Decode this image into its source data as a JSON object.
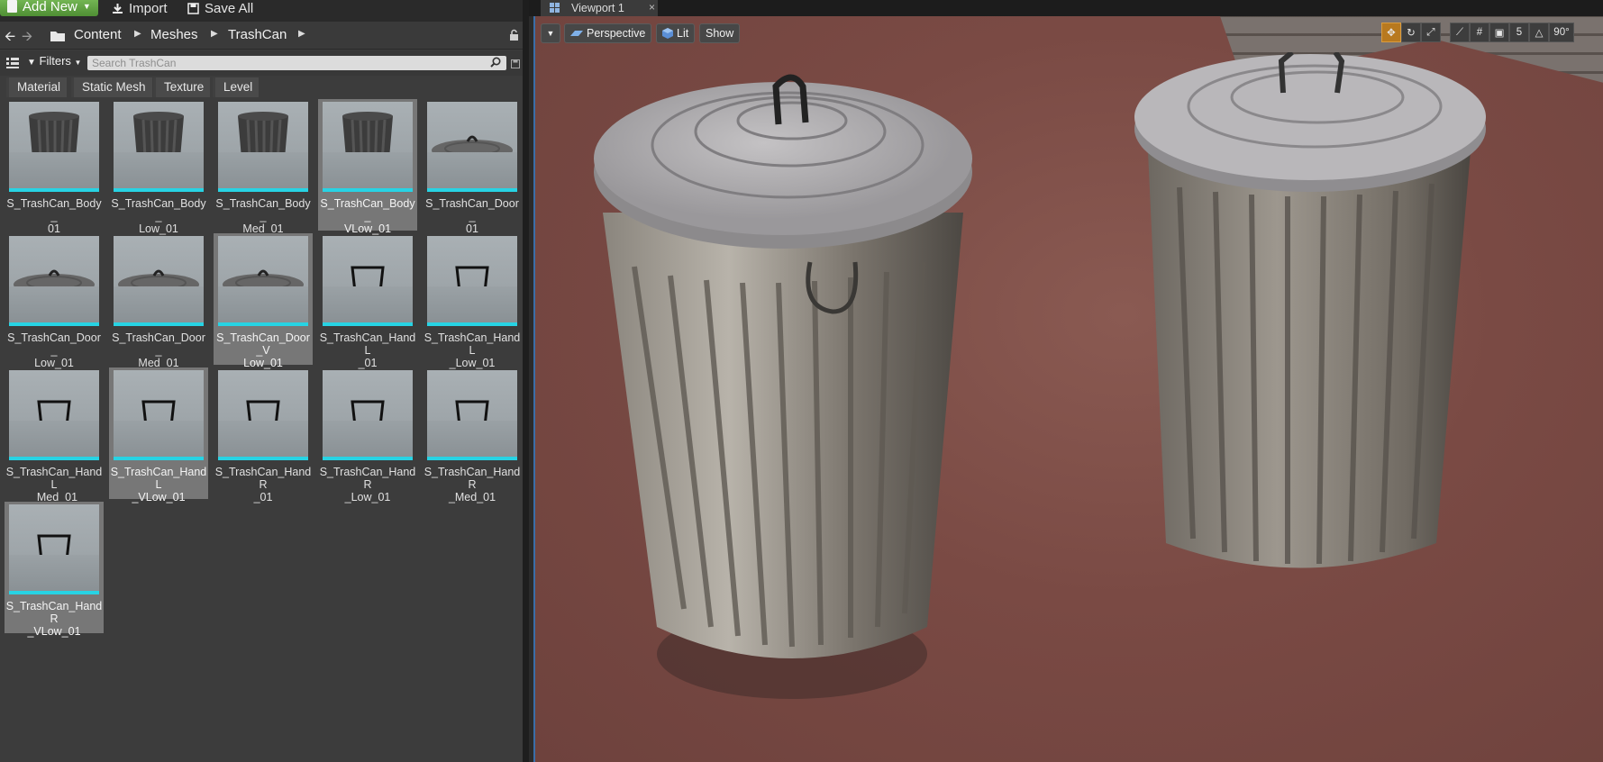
{
  "toolbar": {
    "add_new_label": "Add New",
    "import_label": "Import",
    "save_all_label": "Save All"
  },
  "breadcrumb": {
    "items": [
      "Content",
      "Meshes",
      "TrashCan"
    ]
  },
  "search": {
    "filters_label": "Filters",
    "placeholder": "Search TrashCan"
  },
  "filter_tags": [
    "Material",
    "Static Mesh",
    "Texture",
    "Level"
  ],
  "assets": [
    {
      "label": "S_TrashCan_Body_01",
      "kind": "body",
      "selected": false
    },
    {
      "label": "S_TrashCan_Body_Low_01",
      "kind": "body",
      "selected": false
    },
    {
      "label": "S_TrashCan_Body_Med_01",
      "kind": "body",
      "selected": false
    },
    {
      "label": "S_TrashCan_Body_VLow_01",
      "kind": "body",
      "selected": true
    },
    {
      "label": "S_TrashCan_Door_01",
      "kind": "lid",
      "selected": false
    },
    {
      "label": "S_TrashCan_Door_Low_01",
      "kind": "lid",
      "selected": false
    },
    {
      "label": "S_TrashCan_Door_Med_01",
      "kind": "lid",
      "selected": false
    },
    {
      "label": "S_TrashCan_Door_VLow_01",
      "kind": "lid",
      "selected": true
    },
    {
      "label": "S_TrashCan_HandL_01",
      "kind": "handle",
      "selected": false
    },
    {
      "label": "S_TrashCan_HandL_Low_01",
      "kind": "handle",
      "selected": false
    },
    {
      "label": "S_TrashCan_HandL_Med_01",
      "kind": "handle",
      "selected": false
    },
    {
      "label": "S_TrashCan_HandL_VLow_01",
      "kind": "handle",
      "selected": true
    },
    {
      "label": "S_TrashCan_HandR_01",
      "kind": "handle",
      "selected": false
    },
    {
      "label": "S_TrashCan_HandR_Low_01",
      "kind": "handle",
      "selected": false
    },
    {
      "label": "S_TrashCan_HandR_Med_01",
      "kind": "handle",
      "selected": false
    },
    {
      "label": "S_TrashCan_HandR_VLow_01",
      "kind": "handle",
      "selected": true
    }
  ],
  "asset_label_lines": [
    [
      "S_TrashCan_Body_",
      "01"
    ],
    [
      "S_TrashCan_Body_",
      "Low_01"
    ],
    [
      "S_TrashCan_Body_",
      "Med_01"
    ],
    [
      "S_TrashCan_Body_",
      "VLow_01"
    ],
    [
      "S_TrashCan_Door_",
      "01"
    ],
    [
      "S_TrashCan_Door_",
      "Low_01"
    ],
    [
      "S_TrashCan_Door_",
      "Med_01"
    ],
    [
      "S_TrashCan_Door_V",
      "Low_01"
    ],
    [
      "S_TrashCan_HandL",
      "_01"
    ],
    [
      "S_TrashCan_HandL",
      "_Low_01"
    ],
    [
      "S_TrashCan_HandL",
      "_Med_01"
    ],
    [
      "S_TrashCan_HandL",
      "_VLow_01"
    ],
    [
      "S_TrashCan_HandR",
      "_01"
    ],
    [
      "S_TrashCan_HandR",
      "_Low_01"
    ],
    [
      "S_TrashCan_HandR",
      "_Med_01"
    ],
    [
      "S_TrashCan_HandR",
      "_VLow_01"
    ]
  ],
  "viewport": {
    "tab_label": "Viewport 1",
    "view_mode_label": "Perspective",
    "lighting_label": "Lit",
    "show_label": "Show",
    "grid_snap_value": "5",
    "rotation_snap_value": "90°"
  },
  "colors": {
    "accent_green": "#6aa84f",
    "asset_bar_cyan": "#27d3e4",
    "viewport_border_blue": "#3a6ea8",
    "active_tool_orange": "#f0a030"
  }
}
